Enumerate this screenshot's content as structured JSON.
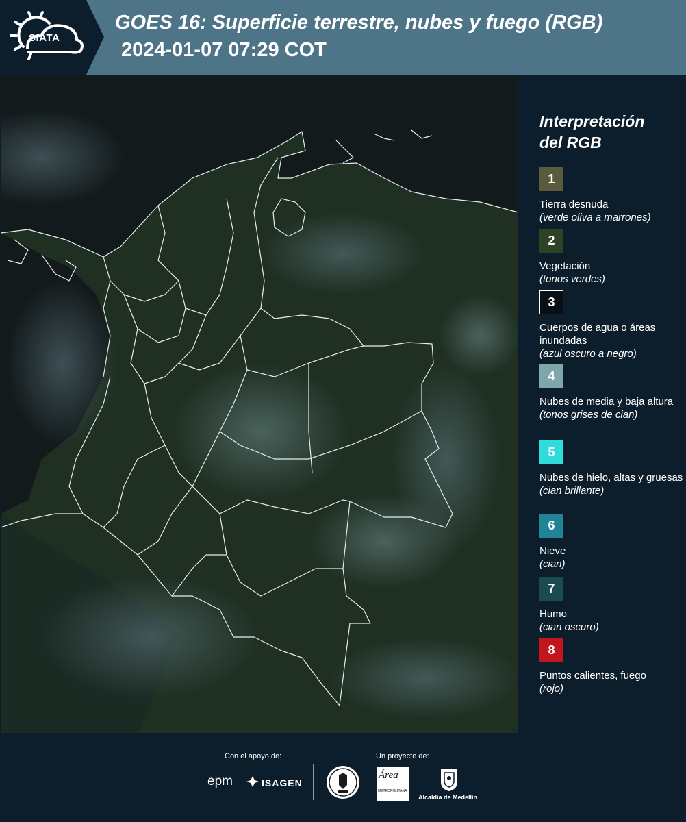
{
  "header": {
    "logo_text": "SIATA",
    "title": "GOES 16: Superficie terrestre, nubes y fuego (RGB)",
    "subtitle": "2024-01-07 07:29 COT"
  },
  "legend": {
    "title_line1": "Interpretación",
    "title_line2": "del RGB",
    "items": [
      {
        "number": "1",
        "label": "Tierra desnuda",
        "desc": "(verde oliva a marrones)",
        "color": "#5a5a3c",
        "border": "#5a5a3c"
      },
      {
        "number": "2",
        "label": "Vegetación",
        "desc": "(tonos verdes)",
        "color": "#2e4326",
        "border": "#2e4326"
      },
      {
        "number": "3",
        "label": "Cuerpos de agua o áreas inundadas",
        "desc": "(azul oscuro a negro)",
        "color": "#0a0f14",
        "border": "#ffffff"
      },
      {
        "number": "4",
        "label": "Nubes de media y baja altura",
        "desc": "(tonos grises de cian)",
        "color": "#7fa6a8",
        "border": "#7fa6a8"
      },
      {
        "number": "5",
        "label": "Nubes de hielo, altas y gruesas",
        "desc": "(cian brillante)",
        "color": "#2fdcdc",
        "border": "#2fdcdc"
      },
      {
        "number": "6",
        "label": "Nieve",
        "desc": "(cian)",
        "color": "#1f8496",
        "border": "#1f8496"
      },
      {
        "number": "7",
        "label": "Humo",
        "desc": "(cian oscuro)",
        "color": "#1c4b4f",
        "border": "#1c4b4f"
      },
      {
        "number": "8",
        "label": "Puntos calientes, fuego",
        "desc": "(rojo)",
        "color": "#c0161c",
        "border": "#c0161c"
      }
    ]
  },
  "footer": {
    "support_label": "Con el apoyo de:",
    "project_label": "Un proyecto de:",
    "epm": "epm",
    "isagen": "ISAGEN",
    "area_logo_text": "Área",
    "area_logo_sub": "METROPOLITANA",
    "medellin": "Alcaldía de Medellín"
  },
  "colors": {
    "header_dark": "#0c1e2b",
    "header_band": "#4e7487",
    "background": "#0c1e2b",
    "map_land": "#1f2f22",
    "map_border": "#e6eef0"
  }
}
